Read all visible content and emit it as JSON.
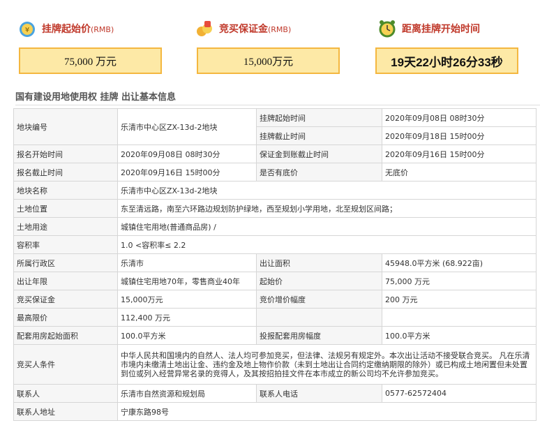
{
  "header": {
    "start_price": {
      "label": "挂牌起始价",
      "unit": "(RMB)",
      "value": "75,000  万元",
      "icon": "money-bag-icon"
    },
    "deposit": {
      "label": "竞买保证金",
      "unit": "(RMB)",
      "value": "15,000万元",
      "icon": "coins-icon"
    },
    "countdown": {
      "label": "距离挂牌开始时间",
      "value": "19天22小时26分33秒",
      "icon": "alarm-clock-icon"
    }
  },
  "section_title": "国有建设用地使用权 挂牌 出让基本信息",
  "colors": {
    "accent_red": "#c0392b",
    "box_fill": "#fde9a6",
    "box_border": "#f4b73f"
  },
  "rows": {
    "plot_no": {
      "label": "地块编号",
      "value": "乐清市中心区ZX-13d-2地块"
    },
    "listing_start": {
      "label": "挂牌起始时间",
      "value": "2020年09月08日 08时30分"
    },
    "listing_end": {
      "label": "挂牌截止时间",
      "value": "2020年09月18日 15时00分"
    },
    "reg_start": {
      "label": "报名开始时间",
      "value": "2020年09月08日 08时30分"
    },
    "deposit_deadline": {
      "label": "保证金到账截止时间",
      "value": "2020年09月16日 15时00分"
    },
    "reg_end": {
      "label": "报名截止时间",
      "value": "2020年09月16日 15时00分"
    },
    "reserve": {
      "label": "是否有底价",
      "value": "无底价"
    },
    "name": {
      "label": "地块名称",
      "value": "乐清市中心区ZX-13d-2地块"
    },
    "location": {
      "label": "土地位置",
      "value": "东至清远路，南至六环路边规划防护绿地，西至规划小学用地，北至规划区间路；"
    },
    "usage": {
      "label": "土地用途",
      "value": "城镇住宅用地(普通商品房) /"
    },
    "far": {
      "label": "容积率",
      "value": "1.0 <容积率≤ 2.2"
    },
    "district": {
      "label": "所属行政区",
      "value": "乐清市"
    },
    "area": {
      "label": "出让面积",
      "value": "45948.0平方米 (68.922亩)"
    },
    "term": {
      "label": "出让年限",
      "value": "城镇住宅用地70年，零售商业40年"
    },
    "start_price": {
      "label": "起始价",
      "value": "75,000 万元"
    },
    "bid_deposit": {
      "label": "竞买保证金",
      "value": "15,000万元"
    },
    "increment": {
      "label": "竞价增价幅度",
      "value": "200 万元"
    },
    "max_price": {
      "label": "最高限价",
      "value": "112,400 万元"
    },
    "housing_start_area": {
      "label": "配套用房起始面积",
      "value": "100.0平方米"
    },
    "housing_increment": {
      "label": "投报配套用房幅度",
      "value": "100.0平方米"
    },
    "conditions": {
      "label": "竞买人条件",
      "value": "中华人民共和国境内的自然人、法人均可参加竞买，但法律、法规另有规定外。本次出让活动不接受联合竞买。 凡在乐清市境内未缴清土地出让金、违约金及地上物作价款（未到土地出让合同约定缴纳期限的除外）或已构成土地闲置但未处置到位或列入经营异常名录的竞得人，及其按招拍挂文件在本市成立的新公司均不允许参加竞买。"
    },
    "contact": {
      "label": "联系人",
      "value": "乐清市自然资源和规划局"
    },
    "phone": {
      "label": "联系人电话",
      "value": "0577-62572404"
    },
    "address": {
      "label": "联系人地址",
      "value": "宁康东路98号"
    }
  }
}
